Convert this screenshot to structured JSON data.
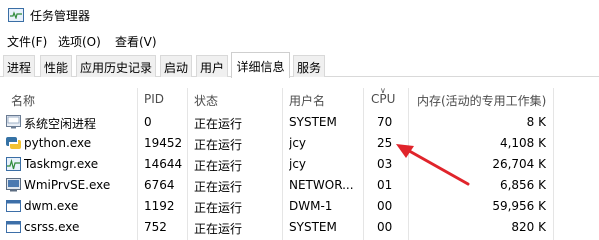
{
  "window": {
    "title": "任务管理器"
  },
  "menu": [
    "文件(F)",
    "选项(O)",
    "查看(V)"
  ],
  "tabs": [
    "进程",
    "性能",
    "应用历史记录",
    "启动",
    "用户",
    "详细信息",
    "服务"
  ],
  "active_tab": "详细信息",
  "columns": [
    "名称",
    "PID",
    "状态",
    "用户名",
    "CPU",
    "内存(活动的专用工作集)"
  ],
  "rows": [
    {
      "name": "系统空闲进程",
      "pid": "0",
      "status": "正在运行",
      "user": "SYSTEM",
      "cpu": "70",
      "mem": "8 K",
      "icon": "system-idle-icon"
    },
    {
      "name": "python.exe",
      "pid": "19452",
      "status": "正在运行",
      "user": "jcy",
      "cpu": "25",
      "mem": "4,108 K",
      "icon": "python-icon"
    },
    {
      "name": "Taskmgr.exe",
      "pid": "14644",
      "status": "正在运行",
      "user": "jcy",
      "cpu": "03",
      "mem": "26,704 K",
      "icon": "task-manager-icon"
    },
    {
      "name": "WmiPrvSE.exe",
      "pid": "6764",
      "status": "正在运行",
      "user": "NETWOR...",
      "cpu": "01",
      "mem": "6,856 K",
      "icon": "wmi-icon"
    },
    {
      "name": "dwm.exe",
      "pid": "1192",
      "status": "正在运行",
      "user": "DWM-1",
      "cpu": "00",
      "mem": "59,956 K",
      "icon": "window-icon"
    },
    {
      "name": "csrss.exe",
      "pid": "752",
      "status": "正在运行",
      "user": "SYSTEM",
      "cpu": "00",
      "mem": "820 K",
      "icon": "window-icon"
    }
  ],
  "colors": {
    "accent": "#0078d7",
    "arrow": "#e0242b",
    "sort_separator": "#e5e5e5"
  }
}
